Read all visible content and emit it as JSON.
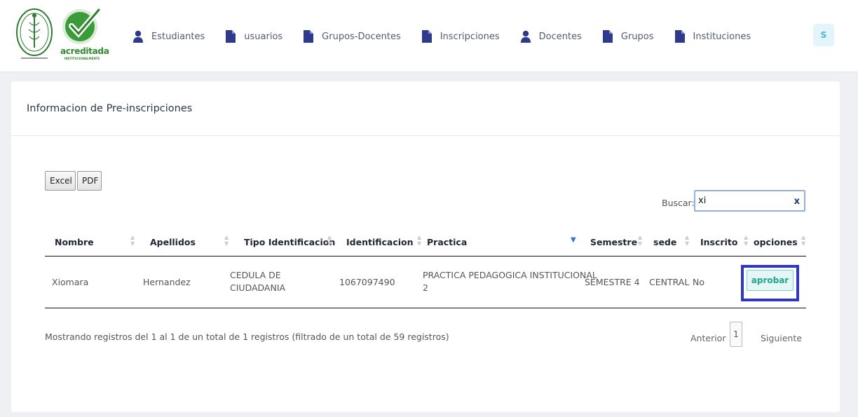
{
  "brand": {
    "acreditada_text": "acreditada",
    "acreditada_subtext": "INSTITUCIONALMENTE"
  },
  "nav": {
    "items": [
      {
        "label": "Estudiantes",
        "icon": "user-icon"
      },
      {
        "label": "usuarios",
        "icon": "file-icon"
      },
      {
        "label": "Grupos-Docentes",
        "icon": "file-icon"
      },
      {
        "label": "Inscripciones",
        "icon": "file-icon"
      },
      {
        "label": "Docentes",
        "icon": "user-icon"
      },
      {
        "label": "Grupos",
        "icon": "file-icon"
      },
      {
        "label": "Instituciones",
        "icon": "file-icon"
      }
    ],
    "avatar_initial": "S"
  },
  "card": {
    "title": "Informacion de Pre-inscripciones"
  },
  "toolbar": {
    "excel_label": "Excel",
    "pdf_label": "PDF",
    "search_label": "Buscar:",
    "search_value": "xi",
    "clear_label": "x"
  },
  "table": {
    "headers": [
      "Nombre",
      "Apellidos",
      "Tipo Identificacion",
      "Identificacion",
      "Practica",
      "Semestre",
      "sede",
      "Inscrito",
      "opciones"
    ],
    "rows": [
      {
        "nombre": "Xiomara",
        "apellidos": "Hernandez",
        "tipo_line1": "CEDULA DE",
        "tipo_line2": "CIUDADANIA",
        "identificacion": "1067097490",
        "practica_line1": "PRACTICA PEDAGOGICA INSTITUCIONAL",
        "practica_line2": "2",
        "semestre": "SEMESTRE 4",
        "sede": "CENTRAL",
        "inscrito": "No",
        "action_label": "aprobar"
      }
    ]
  },
  "footer": {
    "info": "Mostrando registros del 1 al 1 de un total de 1 registros (filtrado de un total de 59 registros)",
    "prev_label": "Anterior",
    "current_page": "1",
    "next_label": "Siguiente"
  },
  "colors": {
    "accent": "#2f36c0",
    "approve_bg": "#e4f7f5",
    "approve_text": "#21a390",
    "nav_icon": "#2e3a8c"
  }
}
